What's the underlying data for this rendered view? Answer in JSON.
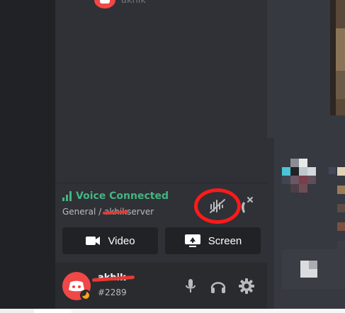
{
  "top_user": {
    "name": "akhik"
  },
  "voice": {
    "status": "Voice Connected",
    "channel_prefix": "General / ",
    "channel_redacted": "akhik",
    "channel_suffix": "server",
    "video_label": "Video",
    "screen_label": "Screen"
  },
  "user": {
    "name": "akhik",
    "discriminator": "#2289"
  },
  "colors": {
    "accent_green": "#43b581",
    "avatar_red": "#f04747",
    "annotation_red": "#ff1a1a",
    "idle_yellow": "#faa61a"
  },
  "icons": [
    "signal-icon",
    "noise-suppression-icon",
    "disconnect-icon",
    "video-icon",
    "screen-share-icon",
    "microphone-icon",
    "headphones-icon",
    "gear-icon",
    "discord-logo-icon"
  ]
}
